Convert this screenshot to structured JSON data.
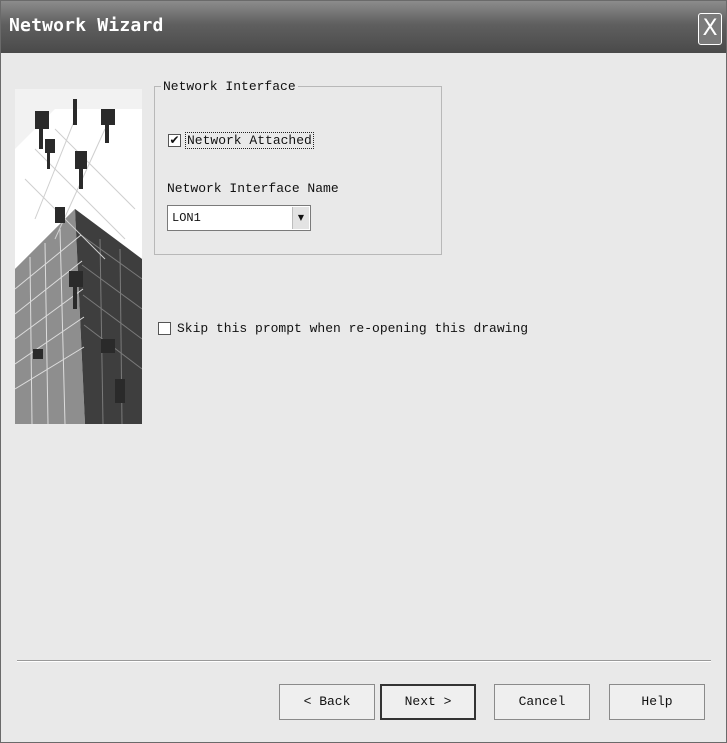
{
  "window": {
    "title": "Network Wizard",
    "close_label": "X"
  },
  "group": {
    "legend": "Network Interface",
    "network_attached": {
      "label": "Network Attached",
      "checked": true,
      "mark": "✔"
    },
    "interface_name_label": "Network Interface Name",
    "interface_select": {
      "value": "LON1",
      "arrow": "▼"
    }
  },
  "skip_prompt": {
    "label": "Skip this prompt when re-opening this drawing",
    "checked": false
  },
  "buttons": {
    "back": "< Back",
    "next": "Next >",
    "cancel": "Cancel",
    "help": "Help"
  }
}
